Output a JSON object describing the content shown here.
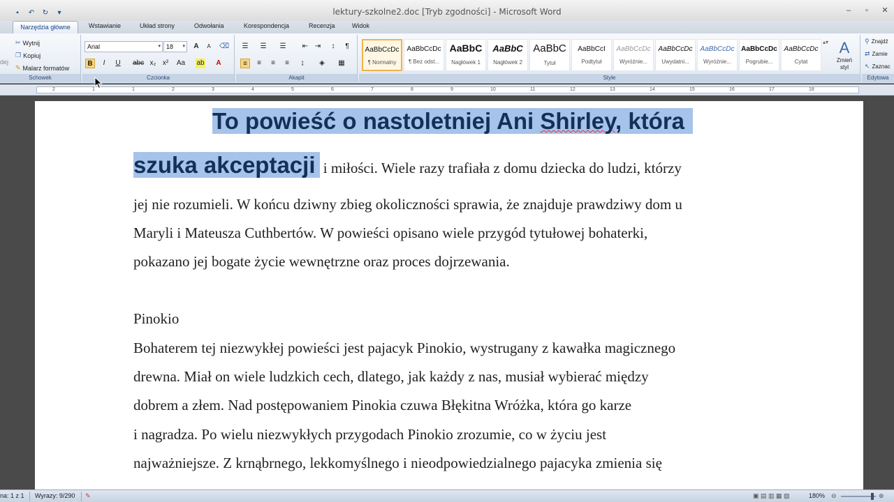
{
  "window": {
    "title": "lektury-szkolne2.doc [Tryb zgodności] - Microsoft Word",
    "controls": [
      "–",
      "▫",
      "✕"
    ]
  },
  "tabs": [
    {
      "label": "Narzędzia główne",
      "active": true
    },
    {
      "label": "Wstawianie"
    },
    {
      "label": "Układ strony"
    },
    {
      "label": "Odwołania"
    },
    {
      "label": "Korespondencja"
    },
    {
      "label": "Recenzja"
    },
    {
      "label": "Widok"
    }
  ],
  "ribbon": {
    "clipboard": {
      "label": "Schowek",
      "paste_fragment": "dej",
      "cut": "Wytnij",
      "copy": "Kopiuj",
      "painter": "Malarz formatów"
    },
    "font": {
      "label": "Czcionka",
      "font_name": "Arial",
      "font_size": "18"
    },
    "paragraph": {
      "label": "Akapit"
    },
    "styles": {
      "label": "Style",
      "items": [
        {
          "sample": "AaBbCcDc",
          "name": "¶ Normalny"
        },
        {
          "sample": "AaBbCcDc",
          "name": "¶ Bez odst..."
        },
        {
          "sample": "AaBbC",
          "name": "Nagłówek 1"
        },
        {
          "sample": "AaBbC",
          "name": "Nagłówek 2"
        },
        {
          "sample": "AaBbC",
          "name": "Tytuł"
        },
        {
          "sample": "AaBbCcI",
          "name": "Podtytuł"
        },
        {
          "sample": "AaBbCcDc",
          "name": "Wyróżnie..."
        },
        {
          "sample": "AaBbCcDc",
          "name": "Uwydatni..."
        },
        {
          "sample": "AaBbCcDc",
          "name": "Wyróżnie..."
        },
        {
          "sample": "AaBbCcDc",
          "name": "Pogrubie..."
        },
        {
          "sample": "AaBbCcDc",
          "name": "Cytat"
        }
      ],
      "change": "Zmień styl"
    },
    "editing": {
      "label": "Edytowa",
      "find": "Znajdź",
      "replace": "Zamie",
      "select": "Zaznac"
    }
  },
  "document": {
    "heading_line1_a": "To powieść o nastoletniej Ani ",
    "heading_line1_b": "Shirley",
    "heading_line1_c": ", która",
    "heading_line2": "szuka akceptacji",
    "line2_rest": " i miłości. Wiele razy trafiała z domu dziecka do ludzi, którzy",
    "line3": "jej nie rozumieli. W końcu dziwny zbieg okoliczności sprawia, że znajduje prawdziwy dom u",
    "line4": "Maryli i Mateusza Cuthbertów. W powieści opisano wiele przygód tytułowej bohaterki,",
    "line5": "pokazano jej bogate życie wewnętrzne oraz proces dojrzewania.",
    "pinokio_title": "Pinokio",
    "p2_line1": "Bohaterem tej niezwykłej powieści jest pajacyk Pinokio, wystrugany z kawałka magicznego",
    "p2_line2": "drewna. Miał on wiele ludzkich cech, dlatego, jak każdy z nas, musiał wybierać między",
    "p2_line3": "dobrem a złem. Nad postępowaniem Pinokia czuwa Błękitna Wróżka, która go karze",
    "p2_line4": "i nagradza. Po wielu niezwykłych przygodach Pinokio zrozumie, co w życiu jest",
    "p2_line5": "najważniejsze. Z krnąbrnego, lekkomyślnego i nieodpowiedzialnego pajacyka zmienia się"
  },
  "status": {
    "page": "na: 1 z 1",
    "words": "Wyrazy: 9/290",
    "zoom": "180%"
  },
  "colors": {
    "selection": "#a6c3ea",
    "heading": "#123058"
  }
}
